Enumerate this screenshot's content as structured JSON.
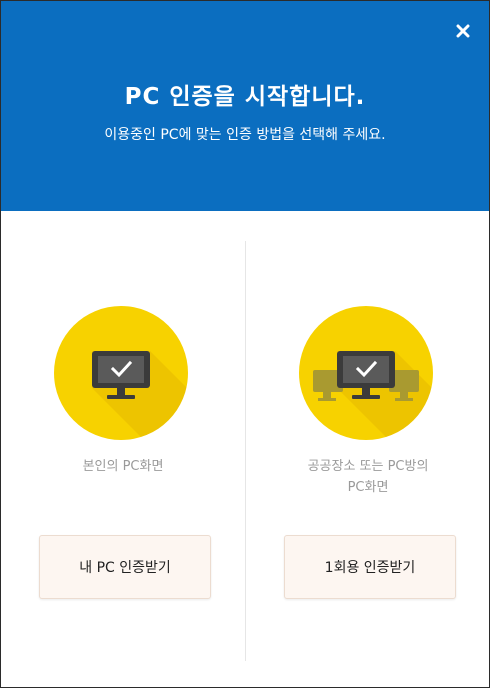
{
  "dialog": {
    "title": "PC 인증을 시작합니다.",
    "subtitle": "이용중인 PC에 맞는 인증 방법을 선택해 주세요.",
    "close_icon": "close-icon"
  },
  "options": [
    {
      "label": "본인의 PC화면",
      "button_label": "내 PC 인증받기",
      "icon": "single-monitor-check-icon"
    },
    {
      "label": "공공장소 또는 PC방의 PC화면",
      "button_label": "1회용 인증받기",
      "icon": "multiple-monitors-check-icon"
    }
  ],
  "colors": {
    "header_bg": "#0b6ec0",
    "circle_bg": "#f7d200",
    "monitor": "#3b3b3b",
    "button_bg": "#fdf6f1",
    "label_text": "#9a9a9a"
  }
}
